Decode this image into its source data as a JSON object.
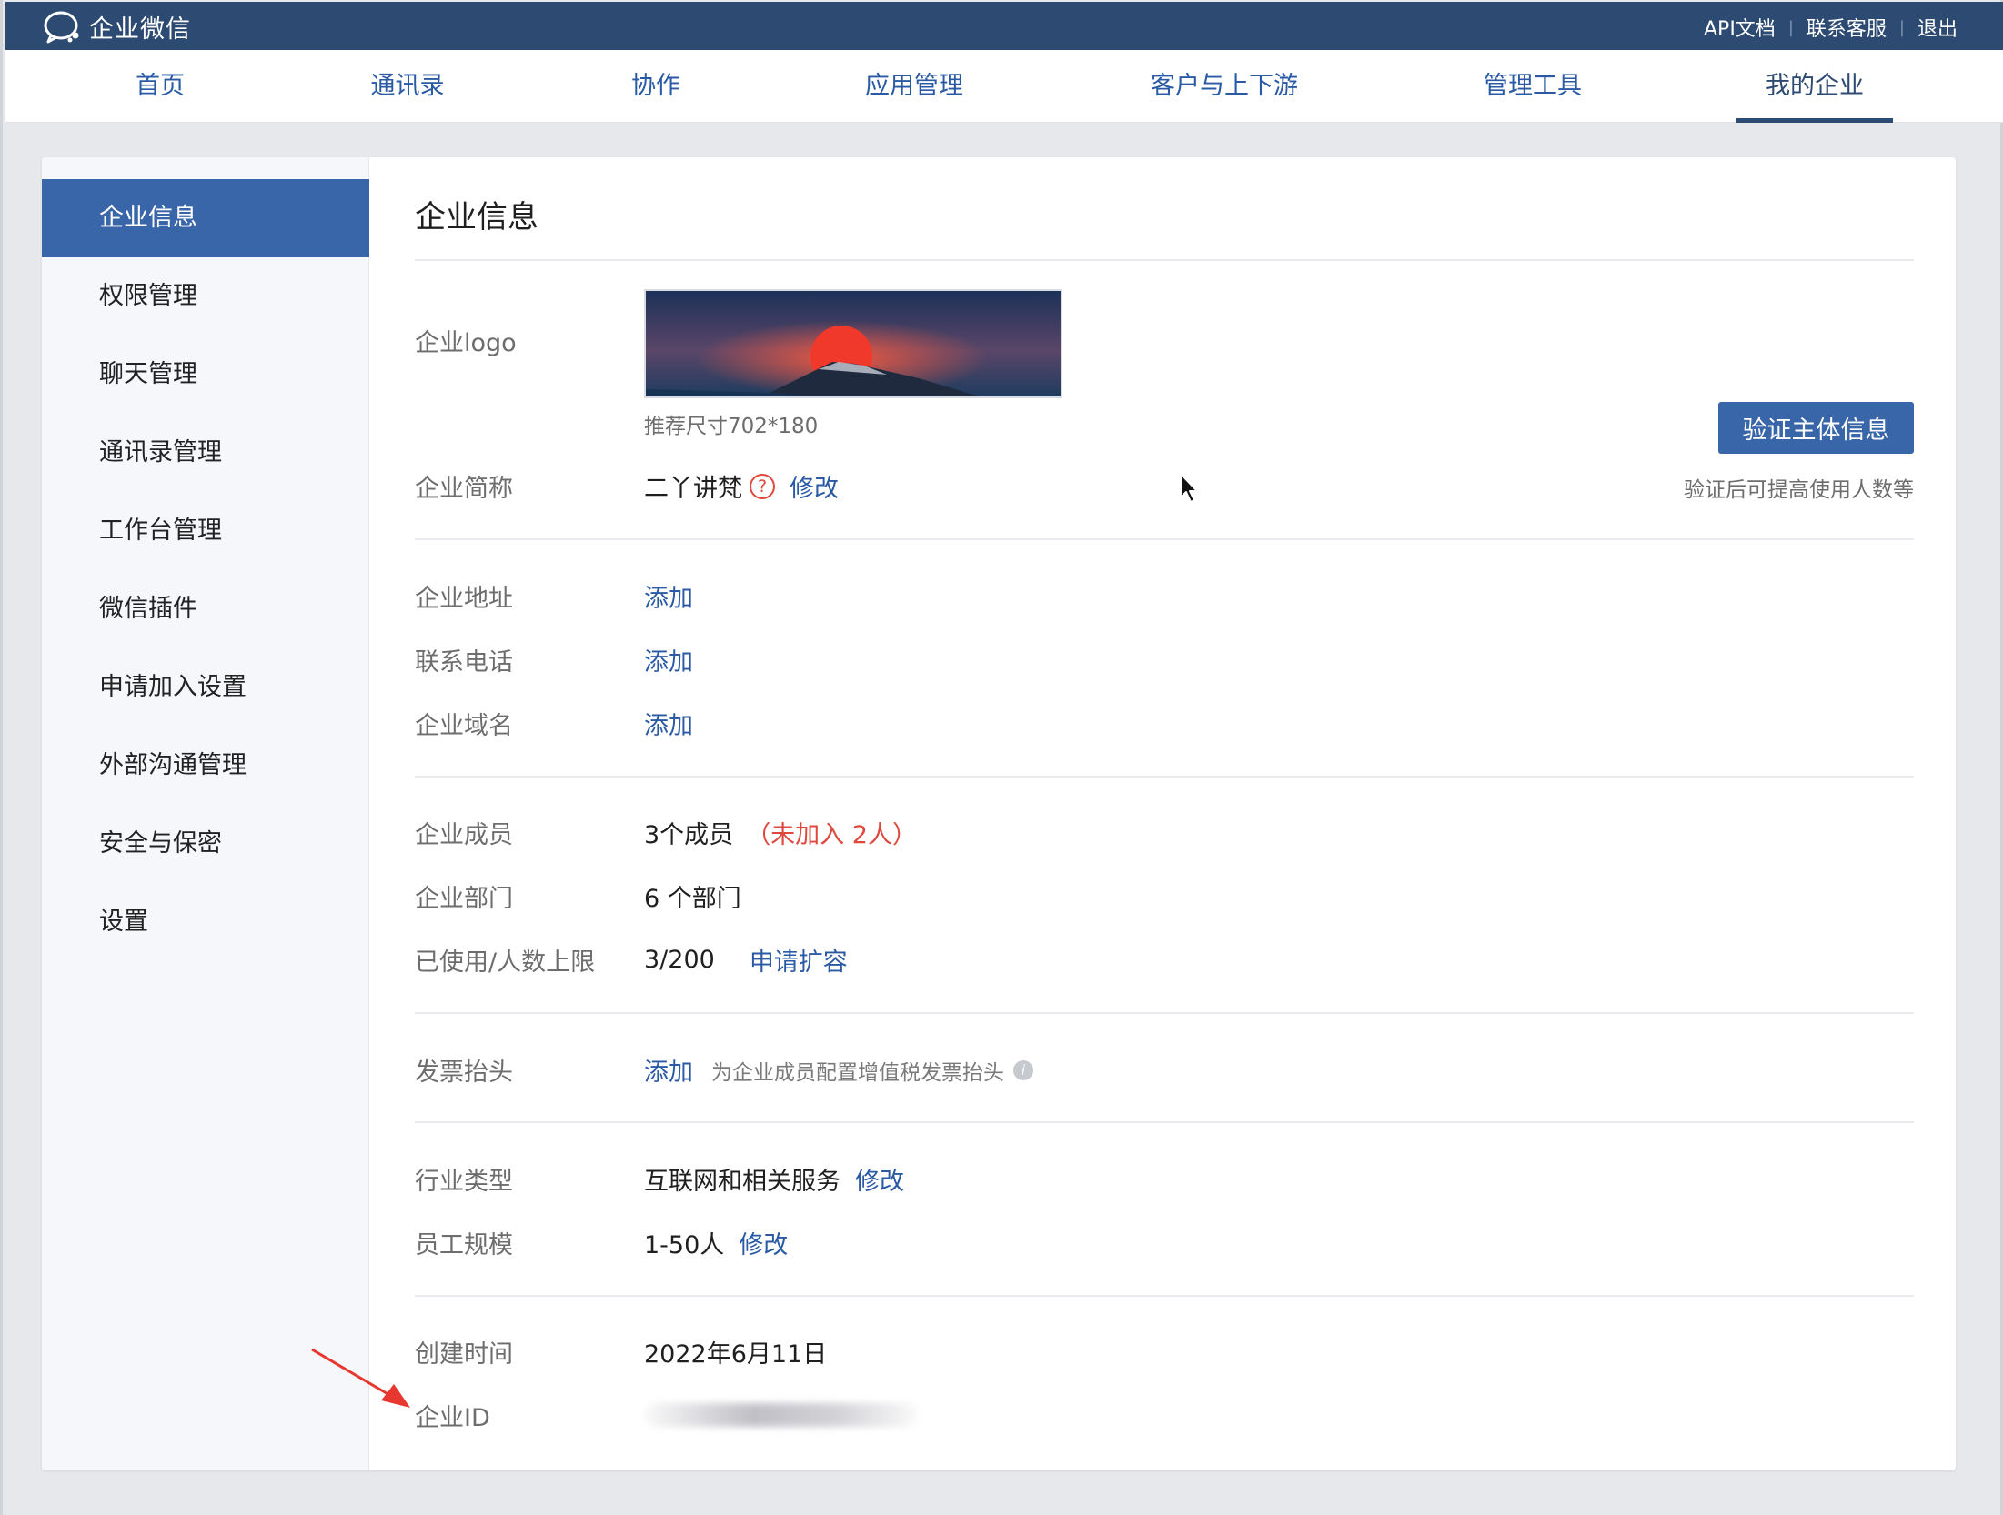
{
  "app": {
    "title": "企业微信"
  },
  "toplinks": [
    "API文档",
    "联系客服",
    "退出"
  ],
  "nav": {
    "items": [
      "首页",
      "通讯录",
      "协作",
      "应用管理",
      "客户与上下游",
      "管理工具",
      "我的企业"
    ],
    "active_index": 6
  },
  "sidebar": {
    "items": [
      "企业信息",
      "权限管理",
      "聊天管理",
      "通讯录管理",
      "工作台管理",
      "微信插件",
      "申请加入设置",
      "外部沟通管理",
      "安全与保密",
      "设置"
    ],
    "active_index": 0
  },
  "page": {
    "title": "企业信息",
    "logo": {
      "label": "企业logo",
      "hint": "推荐尺寸702*180"
    },
    "short_name": {
      "label": "企业简称",
      "value": "二丫讲梵",
      "help_icon": "question-circle-icon",
      "action": "修改"
    },
    "verify": {
      "button": "验证主体信息",
      "hint": "验证后可提高使用人数等"
    },
    "address": {
      "label": "企业地址",
      "action": "添加"
    },
    "phone": {
      "label": "联系电话",
      "action": "添加"
    },
    "domain": {
      "label": "企业域名",
      "action": "添加"
    },
    "members": {
      "label": "企业成员",
      "value": "3个成员",
      "pending": "（未加入 2人）"
    },
    "departments": {
      "label": "企业部门",
      "value": "6 个部门"
    },
    "quota": {
      "label": "已使用/人数上限",
      "value": "3/200",
      "action": "申请扩容"
    },
    "invoice": {
      "label": "发票抬头",
      "action": "添加",
      "note": "为企业成员配置增值税发票抬头",
      "info_icon": "info-icon"
    },
    "industry": {
      "label": "行业类型",
      "value": "互联网和相关服务",
      "action": "修改"
    },
    "size": {
      "label": "员工规模",
      "value": "1-50人",
      "action": "修改"
    },
    "created": {
      "label": "创建时间",
      "value": "2022年6月11日"
    },
    "corp_id": {
      "label": "企业ID"
    }
  },
  "colors": {
    "topbar": "#2c4a72",
    "active_sidebar": "#3866a9",
    "link": "#2b5aa5",
    "warning": "#e0483d",
    "annotation_arrow": "#e8372f"
  }
}
